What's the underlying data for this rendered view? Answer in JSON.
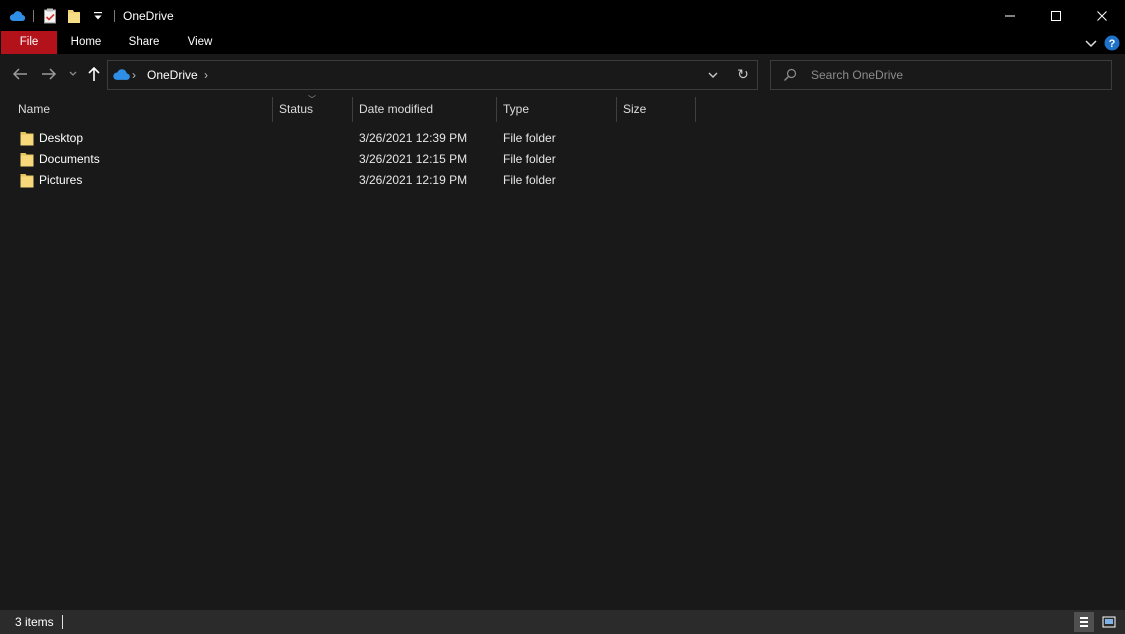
{
  "window": {
    "title": "OneDrive",
    "controls": {
      "minimize": "minimize-icon",
      "maximize": "maximize-icon",
      "close": "close-icon"
    }
  },
  "ribbon": {
    "tabs": [
      {
        "label": "File",
        "accent": "#b3121b"
      },
      {
        "label": "Home"
      },
      {
        "label": "Share"
      },
      {
        "label": "View"
      }
    ]
  },
  "navigation": {
    "breadcrumb": [
      "OneDrive"
    ],
    "search_placeholder": "Search OneDrive"
  },
  "columns": [
    "Name",
    "Status",
    "Date modified",
    "Type",
    "Size"
  ],
  "files": [
    {
      "name": "Desktop",
      "date_modified": "3/26/2021 12:39 PM",
      "type": "File folder",
      "size": ""
    },
    {
      "name": "Documents",
      "date_modified": "3/26/2021 12:15 PM",
      "type": "File folder",
      "size": ""
    },
    {
      "name": "Pictures",
      "date_modified": "3/26/2021 12:19 PM",
      "type": "File folder",
      "size": ""
    }
  ],
  "status_bar": {
    "item_count": "3 items"
  },
  "colors": {
    "background": "#191919",
    "chrome": "#000000",
    "folder": "#f2d272",
    "onedrive": "#2f8fe6"
  }
}
